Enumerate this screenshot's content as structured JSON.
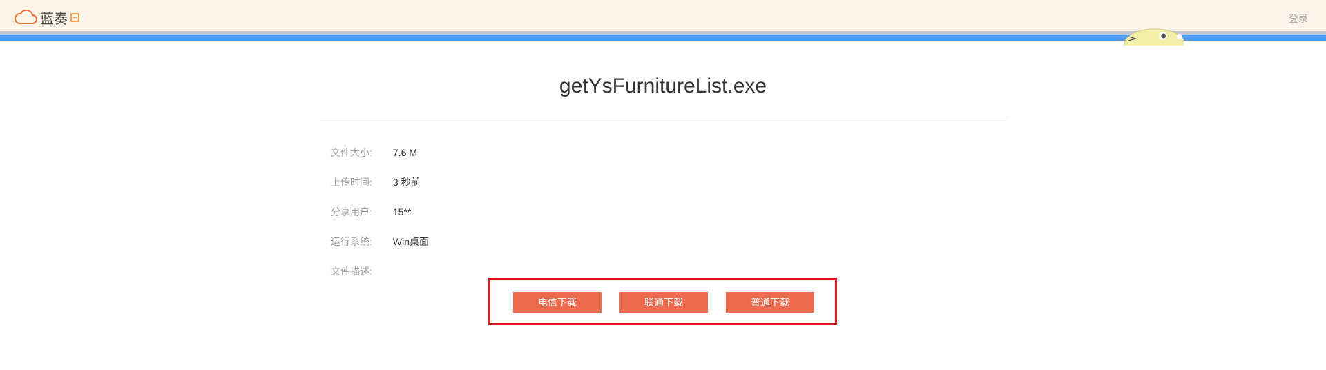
{
  "header": {
    "logo_text": "蓝奏",
    "login_label": "登录",
    "icons": [
      "cloud-icon",
      "logo-box-icon"
    ]
  },
  "file": {
    "name": "getYsFurnitureList.exe",
    "details": [
      {
        "label": "文件大小:",
        "value": "7.6 M"
      },
      {
        "label": "上传时间:",
        "value": "3 秒前"
      },
      {
        "label": "分享用户:",
        "value": "15**"
      },
      {
        "label": "运行系统:",
        "value": "Win桌面"
      },
      {
        "label": "文件描述:",
        "value": ""
      }
    ]
  },
  "downloads": {
    "buttons": [
      {
        "label": "电信下载"
      },
      {
        "label": "联通下载"
      },
      {
        "label": "普通下载"
      }
    ]
  },
  "colors": {
    "header_bg": "#fcf4e8",
    "blue_stripe": "#4e9bf0",
    "button_bg": "#ec6b4f",
    "highlight_frame": "#e0141e"
  }
}
